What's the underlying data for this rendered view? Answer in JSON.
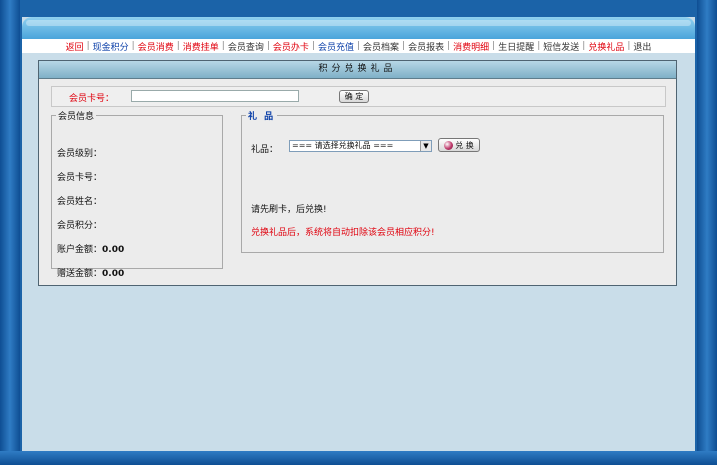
{
  "nav": {
    "items": [
      {
        "label": "返回",
        "color": "red"
      },
      {
        "label": "现金积分",
        "color": "blue"
      },
      {
        "label": "会员消费",
        "color": "red"
      },
      {
        "label": "消费挂单",
        "color": "red"
      },
      {
        "label": "会员查询",
        "color": "gray"
      },
      {
        "label": "会员办卡",
        "color": "red"
      },
      {
        "label": "会员充值",
        "color": "blue"
      },
      {
        "label": "会员档案",
        "color": "gray"
      },
      {
        "label": "会员报表",
        "color": "gray"
      },
      {
        "label": "消费明细",
        "color": "red"
      },
      {
        "label": "生日提醒",
        "color": "gray"
      },
      {
        "label": "短信发送",
        "color": "gray"
      },
      {
        "label": "兑换礼品",
        "color": "red"
      },
      {
        "label": "退出",
        "color": "gray"
      }
    ],
    "separator": "|"
  },
  "panel": {
    "title": "积分兑换礼品"
  },
  "card": {
    "label": "会员卡号：",
    "value": "",
    "confirm_label": "确 定"
  },
  "member": {
    "legend": "会员信息",
    "level_label": "会员级别：",
    "card_label": "会员卡号：",
    "name_label": "会员姓名：",
    "points_label": "会员积分：",
    "balance_label": "账户金额：",
    "balance_value": "0.00",
    "gift_amount_label": "赠送金额：",
    "gift_amount_value": "0.00"
  },
  "gift": {
    "legend": "礼 品",
    "label": "礼品：",
    "select_value": "=== 请选择兑换礼品 ===",
    "exchange_label": "兑 换",
    "hint1": "请先刷卡，后兑换!",
    "hint2": "兑换礼品后，系统将自动扣除该会员相应积分!"
  },
  "colors": {
    "red": "#e0000d",
    "blue": "#0b3fa8",
    "frame": "#1b63a8",
    "content_bg": "#c9dde9"
  }
}
